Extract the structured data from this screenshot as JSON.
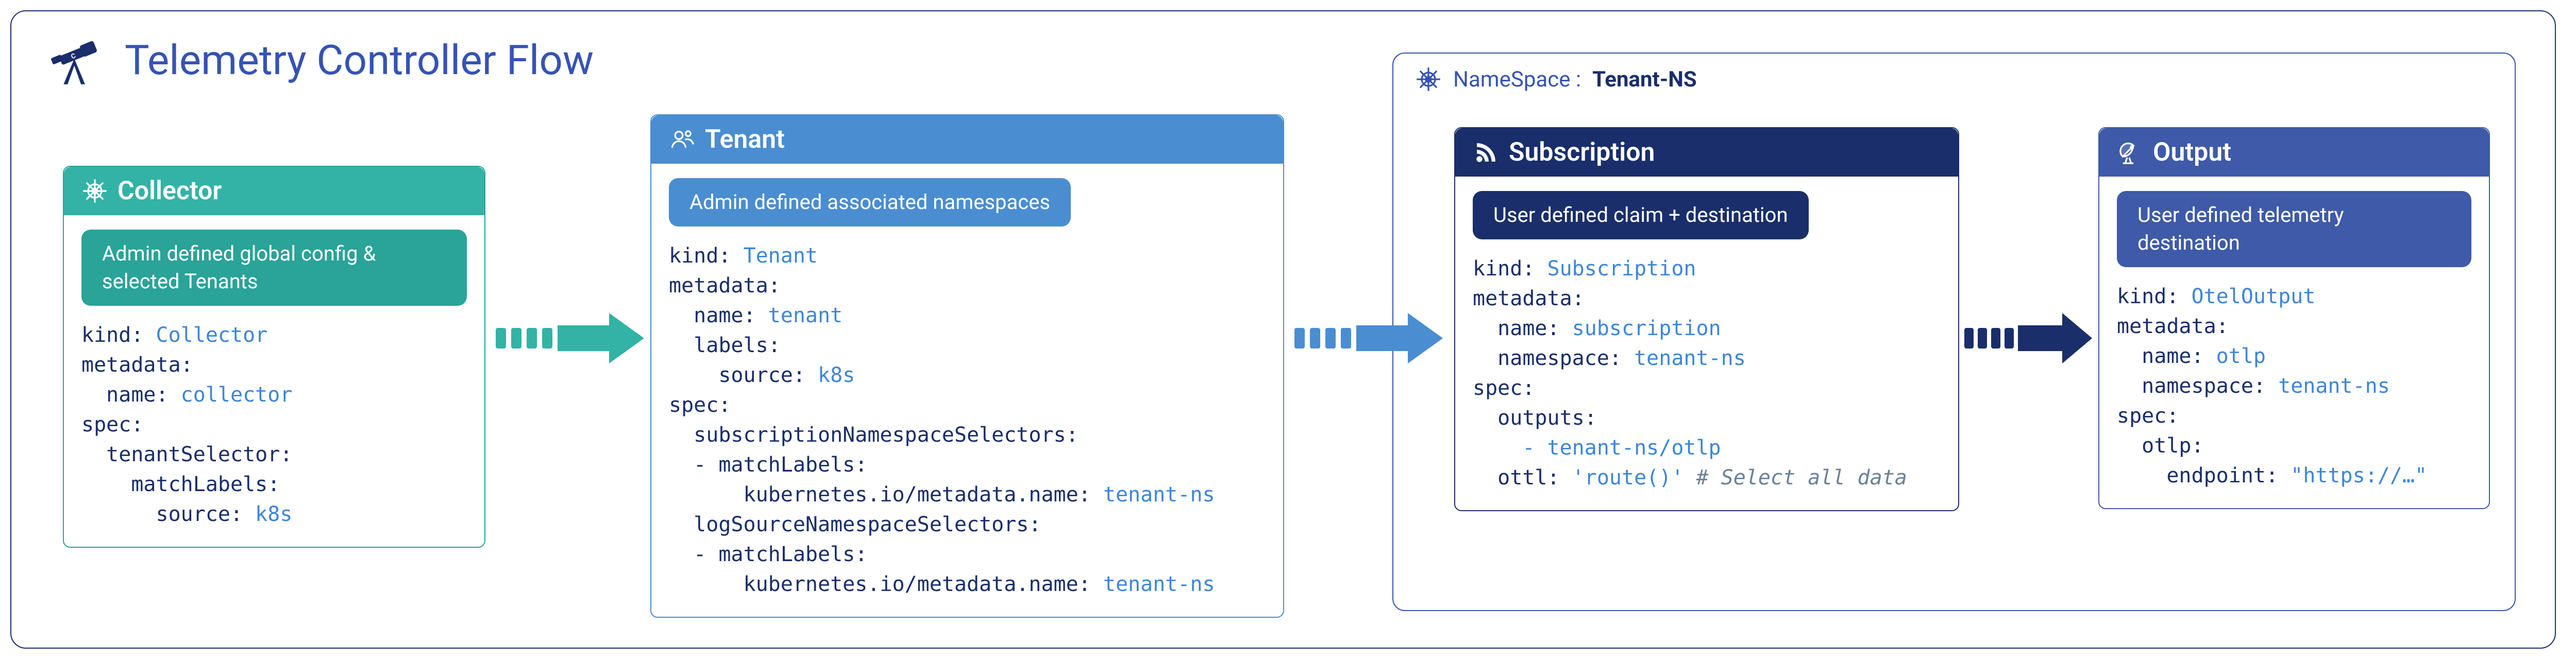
{
  "title": "Telemetry Controller Flow",
  "namespace": {
    "label": "NameSpace :",
    "name": "Tenant-NS"
  },
  "collector": {
    "header": "Collector",
    "pill": "Admin defined global config & selected Tenants",
    "code": {
      "kind_k": "kind:",
      "kind_v": " Collector",
      "metadata_k": "metadata:",
      "name_k": "  name:",
      "name_v": " collector",
      "spec_k": "spec:",
      "tsel_k": "  tenantSelector:",
      "mlab_k": "    matchLabels:",
      "src_k": "      source:",
      "src_v": " k8s"
    }
  },
  "tenant": {
    "header": "Tenant",
    "pill": "Admin defined associated namespaces",
    "code": {
      "kind_k": "kind:",
      "kind_v": " Tenant",
      "metadata_k": "metadata:",
      "name_k": "  name:",
      "name_v": " tenant",
      "labels_k": "  labels:",
      "src_k": "    source:",
      "src_v": " k8s",
      "spec_k": "spec:",
      "sns_k": "  subscriptionNamespaceSelectors:",
      "ml1_k": "  - matchLabels:",
      "mn1_k": "      kubernetes.io/metadata.name:",
      "mn1_v": " tenant-ns",
      "lsns_k": "  logSourceNamespaceSelectors:",
      "ml2_k": "  - matchLabels:",
      "mn2_k": "      kubernetes.io/metadata.name:",
      "mn2_v": " tenant-ns"
    }
  },
  "subscription": {
    "header": "Subscription",
    "pill": "User defined claim + destination",
    "code": {
      "kind_k": "kind:",
      "kind_v": " Subscription",
      "metadata_k": "metadata:",
      "name_k": "  name:",
      "name_v": " subscription",
      "ns_k": "  namespace:",
      "ns_v": " tenant-ns",
      "spec_k": "spec:",
      "out_k": "  outputs:",
      "out_v": "    - tenant-ns/otlp",
      "ottl_k": "  ottl:",
      "ottl_v": " 'route()'",
      "ottl_c": " # Select all data"
    }
  },
  "output": {
    "header": "Output",
    "pill": "User defined telemetry destination",
    "code": {
      "kind_k": "kind:",
      "kind_v": " OtelOutput",
      "metadata_k": "metadata:",
      "name_k": "  name:",
      "name_v": " otlp",
      "ns_k": "  namespace:",
      "ns_v": " tenant-ns",
      "spec_k": "spec:",
      "otlp_k": "  otlp:",
      "ep_k": "    endpoint:",
      "ep_v": " \"https://…\""
    }
  },
  "arrows": {
    "a1_color": "#33b2a6",
    "a2_color": "#4a8dd1",
    "a3_color": "#1a2e6b"
  }
}
